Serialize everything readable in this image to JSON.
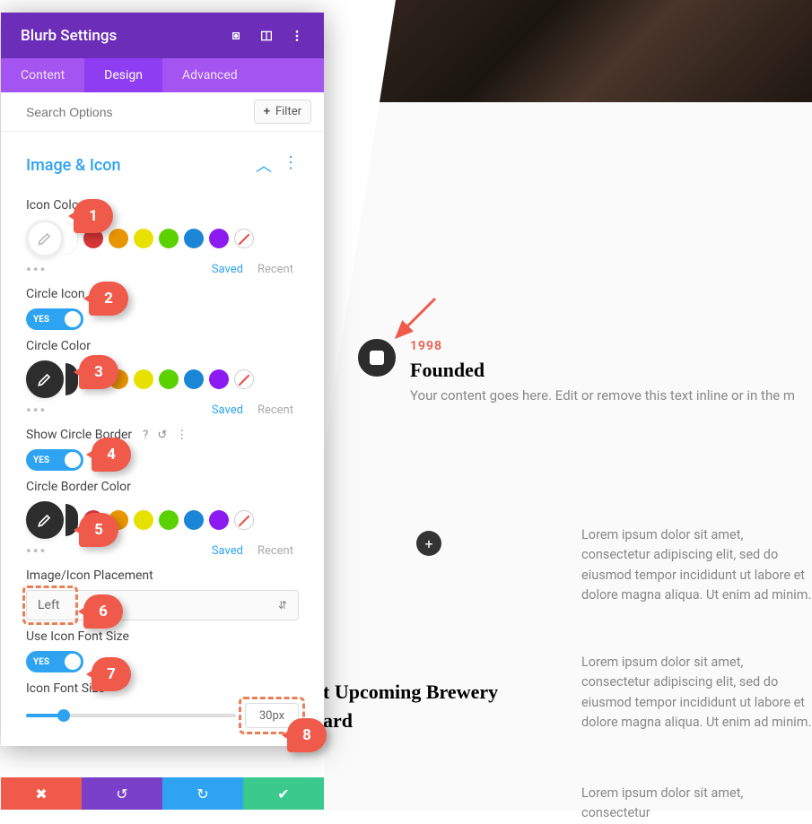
{
  "panel": {
    "title": "Blurb Settings",
    "tabs": [
      "Content",
      "Design",
      "Advanced"
    ],
    "active_tab": 1,
    "search_placeholder": "Search Options",
    "filter_label": "Filter",
    "section_title": "Image & Icon",
    "labels": {
      "icon_color": "Icon Color",
      "circle_icon": "Circle Icon",
      "circle_color": "Circle Color",
      "show_circle_border": "Show Circle Border",
      "circle_border_color": "Circle Border Color",
      "placement": "Image/Icon Placement",
      "use_icon_font_size": "Use Icon Font Size",
      "icon_font_size": "Icon Font Size"
    },
    "values": {
      "toggle_on": "YES",
      "placement": "Left",
      "icon_font_size": "30px"
    },
    "swatch_links": {
      "saved": "Saved",
      "recent": "Recent"
    },
    "palette": [
      "#d63638",
      "#e89500",
      "#e8e100",
      "#5bd200",
      "#1b86d6",
      "#8c1bf2"
    ]
  },
  "callouts": [
    "1",
    "2",
    "3",
    "4",
    "5",
    "6",
    "7",
    "8"
  ],
  "preview": {
    "year": "1998",
    "heading": "Founded",
    "blurb_text": "Your content goes here. Edit or remove this text inline or in the m",
    "lorem": "Lorem ipsum dolor sit amet, consectetur adipiscing elit, sed do eiusmod tempor incididunt ut labore et dolore magna aliqua. Ut enim ad minim.",
    "lorem_cut": "Lorem ipsum dolor sit amet, consectetur",
    "award_h1": "t Upcoming Brewery",
    "award_h2": "ard"
  }
}
